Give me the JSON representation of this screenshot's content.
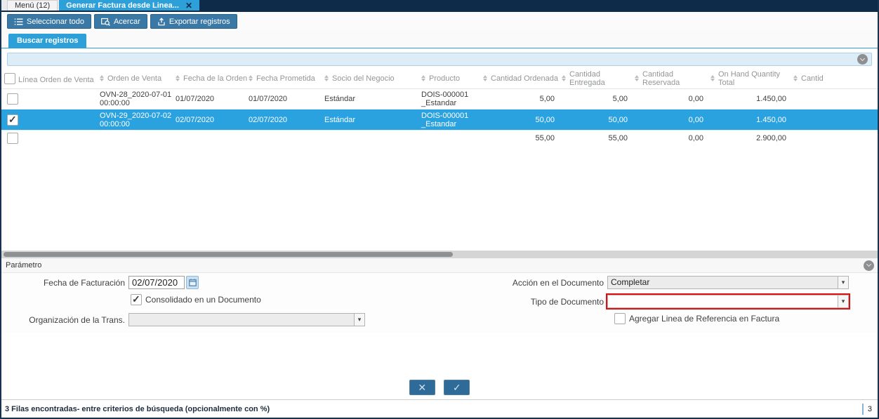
{
  "tabs": {
    "menu_label": "Menú (12)",
    "active_label": "Generar Factura desde Linea...",
    "close_glyph": "✕"
  },
  "toolbar": {
    "select_all_label": "Seleccionar todo",
    "zoom_label": "Acercar",
    "export_label": "Exportar registros"
  },
  "finder": {
    "tab_label": "Buscar registros",
    "search_value": ""
  },
  "table": {
    "columns": [
      "Línea Orden de Venta",
      "Orden de Venta",
      "Fecha de la Orden",
      "Fecha Prometida",
      "Socio del Negocio",
      "Producto",
      "Cantidad Ordenada",
      "Cantidad Entregada",
      "Cantidad Reservada",
      "On Hand Quantity Total",
      "Cantid"
    ],
    "rows": [
      {
        "order": "OVN-28_2020-07-01 00:00:00",
        "order_date": "01/07/2020",
        "promised_date": "01/07/2020",
        "partner": "Estándar",
        "product": "DOIS-000001 _Estandar",
        "qty_ordered": "5,00",
        "qty_delivered": "5,00",
        "qty_reserved": "0,00",
        "on_hand": "1.450,00"
      },
      {
        "order": "OVN-29_2020-07-02 00:00:00",
        "order_date": "02/07/2020",
        "promised_date": "02/07/2020",
        "partner": "Estándar",
        "product": "DOIS-000001 _Estandar",
        "qty_ordered": "50,00",
        "qty_delivered": "50,00",
        "qty_reserved": "0,00",
        "on_hand": "1.450,00"
      }
    ],
    "summary": {
      "qty_ordered": "55,00",
      "qty_delivered": "55,00",
      "qty_reserved": "0,00",
      "on_hand": "2.900,00"
    }
  },
  "params": {
    "title": "Parámetro",
    "invoice_date_label": "Fecha de Facturación",
    "invoice_date_value": "02/07/2020",
    "consolidated_label": "Consolidado en un Documento",
    "org_label": "Organización de la Trans.",
    "org_value": "",
    "doc_action_label": "Acción en el Documento",
    "doc_action_value": "Completar",
    "doc_type_label": "Tipo de Documento",
    "doc_type_value": "",
    "add_ref_label": "Agregar Linea de Referencia en Factura",
    "dropdown_glyph": "▾"
  },
  "confirm": {
    "cancel_glyph": "✕",
    "ok_glyph": "✓"
  },
  "statusbar": {
    "message": "3 Filas encontradas- entre criterios de búsqueda (opcionalmente con %)",
    "count": "3"
  },
  "colors": {
    "accent_blue": "#2da0d9",
    "navy": "#0e2b49",
    "button_blue": "#3a79a6",
    "selected_row": "#2ba2e0",
    "alert_red": "#dd1111"
  }
}
